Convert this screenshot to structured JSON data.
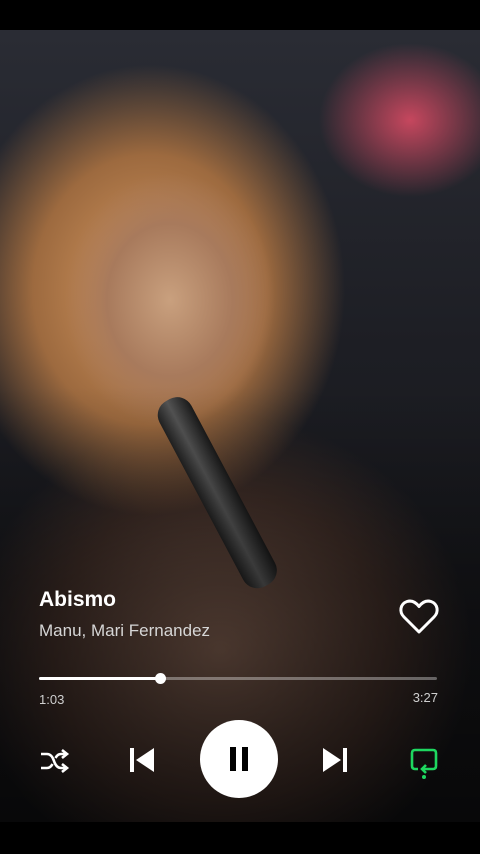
{
  "track": {
    "title": "Abismo",
    "artists": "Manu, Mari Fernandez",
    "liked": false
  },
  "playback": {
    "elapsed": "1:03",
    "total": "3:27",
    "progress_fraction": 0.304,
    "state": "playing",
    "repeat_active": true
  },
  "icons": {
    "heart": "heart-outline-icon",
    "shuffle": "shuffle-icon",
    "previous": "skip-previous-icon",
    "pause": "pause-icon",
    "next": "skip-next-icon",
    "repeat": "repeat-icon"
  },
  "colors": {
    "accent": "#1ED760",
    "text_secondary": "#D6D6D6"
  }
}
